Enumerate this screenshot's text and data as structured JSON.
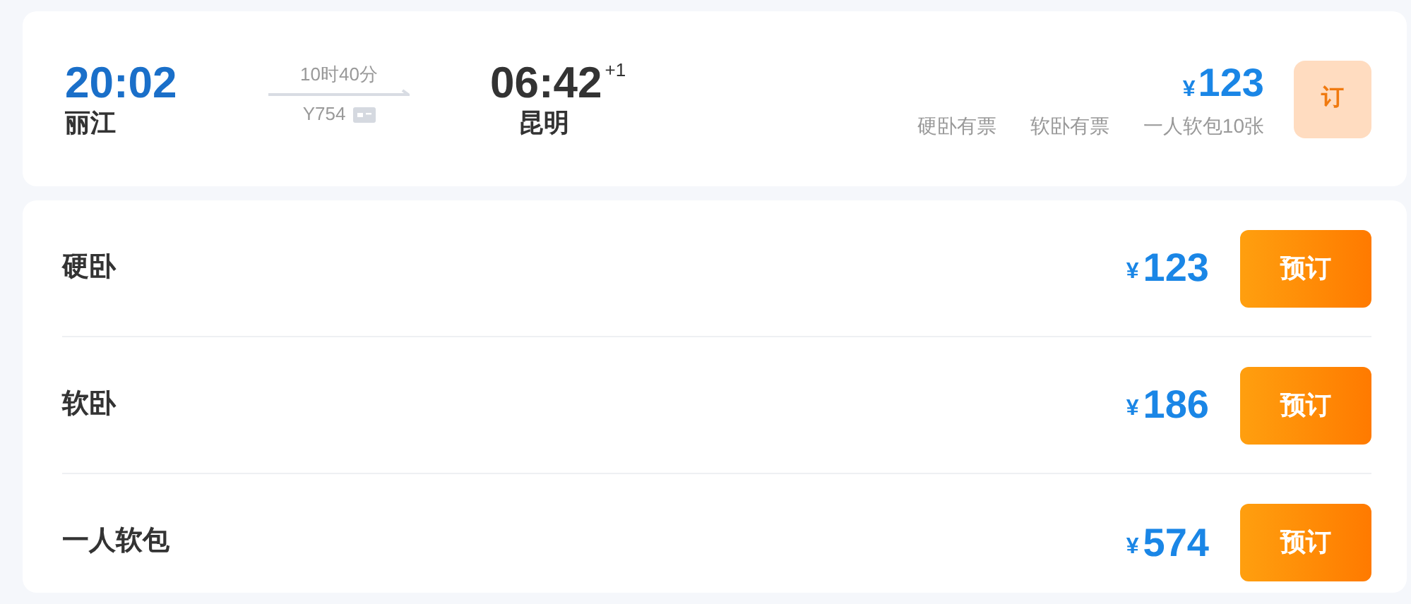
{
  "train": {
    "depart_time": "20:02",
    "depart_station": "丽江",
    "duration": "10时40分",
    "train_no": "Y754",
    "arrive_time": "06:42",
    "day_offset": "+1",
    "arrive_station": "昆明",
    "currency": "¥",
    "price": "123",
    "availability": [
      "硬卧有票",
      "软卧有票",
      "一人软包10张"
    ],
    "book_label": "订"
  },
  "seats": [
    {
      "name": "硬卧",
      "currency": "¥",
      "price": "123",
      "book_label": "预订"
    },
    {
      "name": "软卧",
      "currency": "¥",
      "price": "186",
      "book_label": "预订"
    },
    {
      "name": "一人软包",
      "currency": "¥",
      "price": "574",
      "book_label": "预订"
    }
  ]
}
